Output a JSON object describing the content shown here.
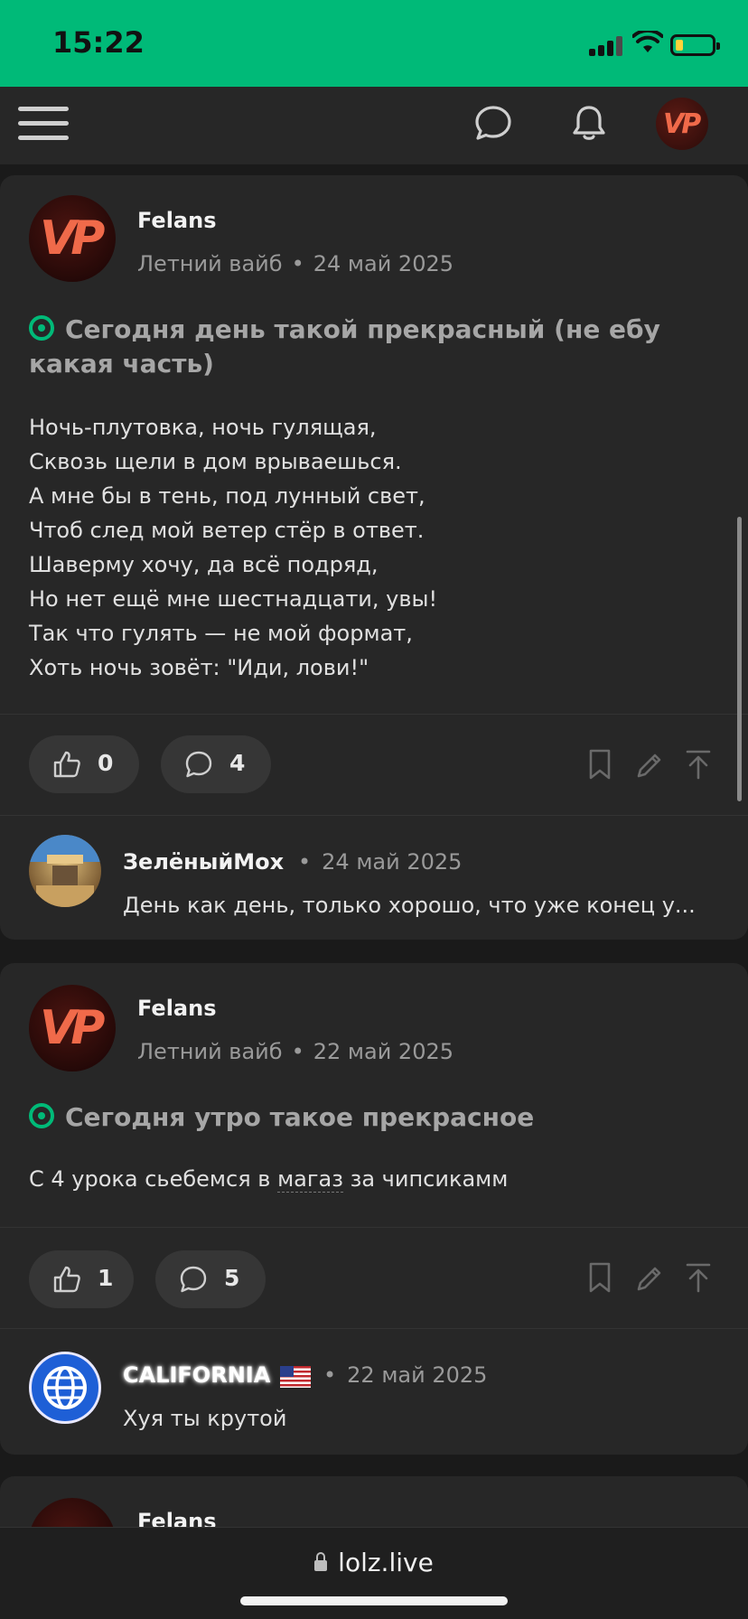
{
  "status_bar": {
    "time": "15:22"
  },
  "header": {
    "icons": [
      "menu-icon",
      "chat-icon",
      "bell-icon"
    ],
    "avatar_text": "VP"
  },
  "posts": [
    {
      "author": "Felans",
      "user_title": "Летний вайб",
      "date": "24 май 2025",
      "title": "Сегодня день такой прекрасный (не ебу какая часть)",
      "body": [
        "Ночь-плутовка, ночь гулящая,",
        "Сквозь щели в дом врываешься.",
        "А мне бы в тень, под лунный свет,",
        "Чтоб след мой ветер стёр в ответ.",
        "Шаверму хочу, да всё подряд,",
        "Но нет ещё мне шестнадцати, увы!",
        "Так что гулять — не мой формат,",
        "Хоть ночь зовёт: \"Иди, лови!\""
      ],
      "likes": "0",
      "comments": "4",
      "last_comment": {
        "author": "ЗелёныйМох",
        "date": "24 май 2025",
        "text": "День как день, только хорошо, что уже конец у..."
      }
    },
    {
      "author": "Felans",
      "user_title": "Летний вайб",
      "date": "22 май 2025",
      "title": "Сегодня утро такое прекрасное",
      "body_pre": "С 4 урока сьебемся в ",
      "body_link": "магаз",
      "body_post": " за чипсикамм",
      "likes": "1",
      "comments": "5",
      "last_comment": {
        "author": "CALIFORNIA",
        "date": "22 май 2025",
        "text": "Хуя ты крутой"
      }
    },
    {
      "author": "Felans"
    }
  ],
  "browser": {
    "url": "lolz.live"
  },
  "colors": {
    "accent": "#00ba78",
    "card": "#272727",
    "background": "#1a1a1a"
  }
}
